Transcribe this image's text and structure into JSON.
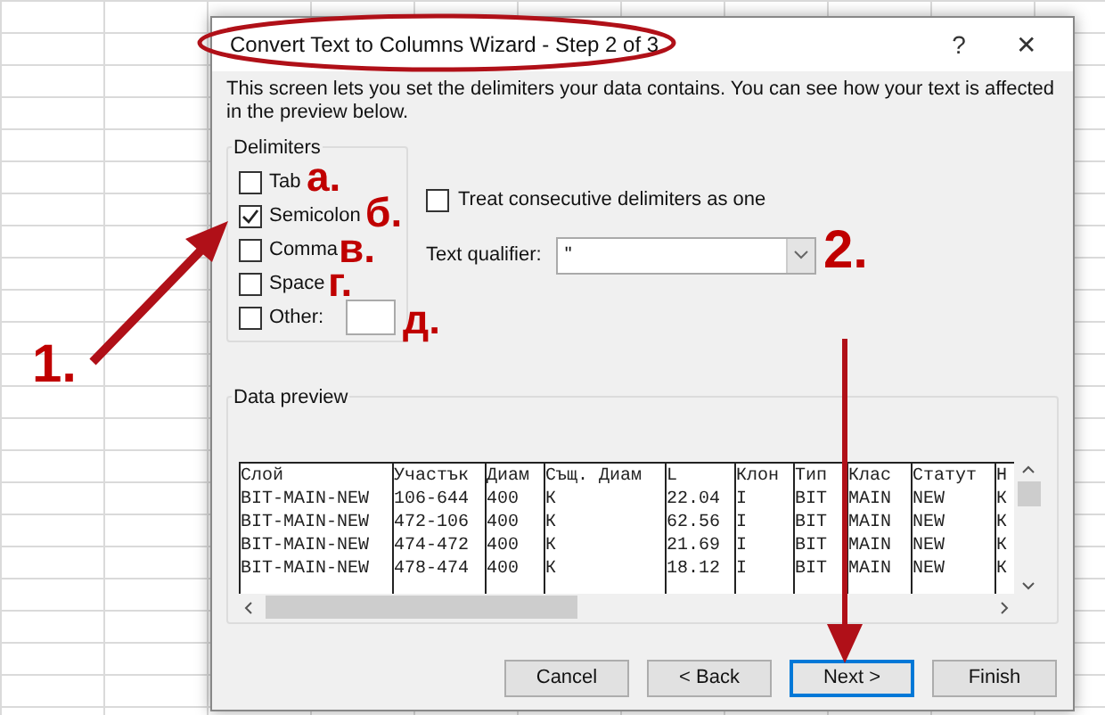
{
  "window": {
    "title": "Convert Text to Columns Wizard - Step 2 of 3",
    "help": "?",
    "close": "✕"
  },
  "description": "This screen lets you set the delimiters your data contains.  You can see how your text is affected in the preview below.",
  "delimiters": {
    "title": "Delimiters",
    "options": [
      {
        "label": "Tab",
        "checked": false
      },
      {
        "label": "Semicolon",
        "checked": true
      },
      {
        "label": "Comma",
        "checked": false
      },
      {
        "label": "Space",
        "checked": false
      },
      {
        "label": "Other:",
        "checked": false,
        "kind": "field"
      }
    ]
  },
  "treat_consecutive": {
    "label": "Treat consecutive delimiters as one",
    "checked": false
  },
  "text_qualifier": {
    "label": "Text qualifier:",
    "value": "\""
  },
  "data_preview": {
    "title": "Data preview",
    "columns": [
      "Слой",
      "Участък",
      "Диам",
      "Същ. Диам",
      "L",
      "Клон",
      "Тип",
      "Клас",
      "Статут",
      "Н"
    ],
    "rows": [
      [
        "BIT-MAIN-NEW",
        "106-644",
        "400",
        "К",
        "22.04",
        "I",
        "BIT",
        "MAIN",
        "NEW",
        "К"
      ],
      [
        "BIT-MAIN-NEW",
        "472-106",
        "400",
        "К",
        "62.56",
        "I",
        "BIT",
        "MAIN",
        "NEW",
        "К"
      ],
      [
        "BIT-MAIN-NEW",
        "474-472",
        "400",
        "К",
        "21.69",
        "I",
        "BIT",
        "MAIN",
        "NEW",
        "К"
      ],
      [
        "BIT-MAIN-NEW",
        "478-474",
        "400",
        "К",
        "18.12",
        "I",
        "BIT",
        "MAIN",
        "NEW",
        "К"
      ]
    ]
  },
  "buttons": [
    {
      "label": "Cancel",
      "default": false
    },
    {
      "label": "< Back",
      "default": false
    },
    {
      "label": "Next >",
      "default": true
    },
    {
      "label": "Finish",
      "default": false
    }
  ],
  "annotations": [
    {
      "text": "1."
    },
    {
      "text": "2."
    },
    {
      "text": "а."
    },
    {
      "text": "б."
    },
    {
      "text": "в."
    },
    {
      "text": "г."
    },
    {
      "text": "д."
    }
  ]
}
